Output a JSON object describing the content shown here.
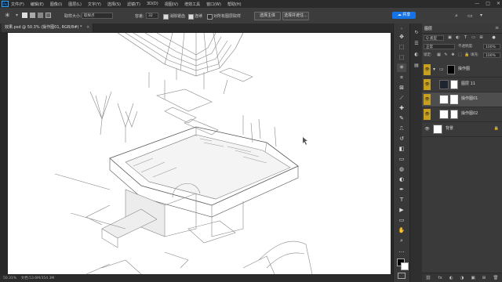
{
  "app": {
    "logo": "Ps"
  },
  "menu": [
    "文件(F)",
    "编辑(E)",
    "图像(I)",
    "图层(L)",
    "文字(Y)",
    "选择(S)",
    "滤镜(T)",
    "3D(D)",
    "视图(V)",
    "增效工具",
    "窗口(W)",
    "帮助(H)"
  ],
  "window_controls": [
    "—",
    "□",
    "✕"
  ],
  "options": {
    "sample_label": "取样大小:",
    "sample_value": "取样点",
    "tolerance_label": "容差:",
    "tolerance_value": "32",
    "antialias_label": "消除锯齿",
    "contiguous_label": "连续",
    "all_layers_label": "对所有图层取样",
    "select_subject": "选择主体",
    "select_mask": "选择并遮住...",
    "share": "共享"
  },
  "document": {
    "tab_title": "效果.psd @ 50.3% (操作图01, RGB/8#) *",
    "close": "×"
  },
  "status": {
    "zoom": "50.31%",
    "doc_size": "文档:53.6M/354.3M"
  },
  "tools": [
    "move-icon",
    "artboard-icon",
    "marquee-icon",
    "lasso-icon",
    "magic-wand-icon",
    "crop-icon",
    "frame-icon",
    "eyedropper-icon",
    "healing-icon",
    "brush-icon",
    "stamp-icon",
    "history-brush-icon",
    "eraser-icon",
    "gradient-icon",
    "blur-icon",
    "dodge-icon",
    "pen-icon",
    "type-icon",
    "path-select-icon",
    "shape-icon",
    "hand-icon",
    "zoom-icon",
    "more-icon"
  ],
  "tool_glyphs": [
    "✥",
    "⬚",
    "⬚",
    "ʘ",
    "✳",
    "⌗",
    "⊠",
    "⟋",
    "✚",
    "✎",
    "⎍",
    "↺",
    "◧",
    "▭",
    "◍",
    "◐",
    "✒",
    "T",
    "▶",
    "▭",
    "✋",
    "⌕",
    "…"
  ],
  "layers_panel": {
    "tab": "图层",
    "kind_label": "Q 类型",
    "mode_value": "正常",
    "opacity_label": "不透明度:",
    "opacity_value": "100%",
    "lock_label": "锁定:",
    "fill_label": "填充:",
    "fill_value": "100%",
    "layers": [
      {
        "name": "操作图",
        "type": "group",
        "visible": true
      },
      {
        "name": "图层 11",
        "type": "layer",
        "visible": true
      },
      {
        "name": "操作图01",
        "type": "layer",
        "visible": true,
        "selected": true
      },
      {
        "name": "操作图02",
        "type": "layer",
        "visible": true
      },
      {
        "name": "背景",
        "type": "background",
        "visible": true
      }
    ],
    "footer": [
      "⛓",
      "fx",
      "◐",
      "◑",
      "▣",
      "⊞",
      "🗑"
    ]
  },
  "colors": {
    "accent": "#31a8ff",
    "eye_highlight": "#c8a01e",
    "share": "#1473e6"
  }
}
